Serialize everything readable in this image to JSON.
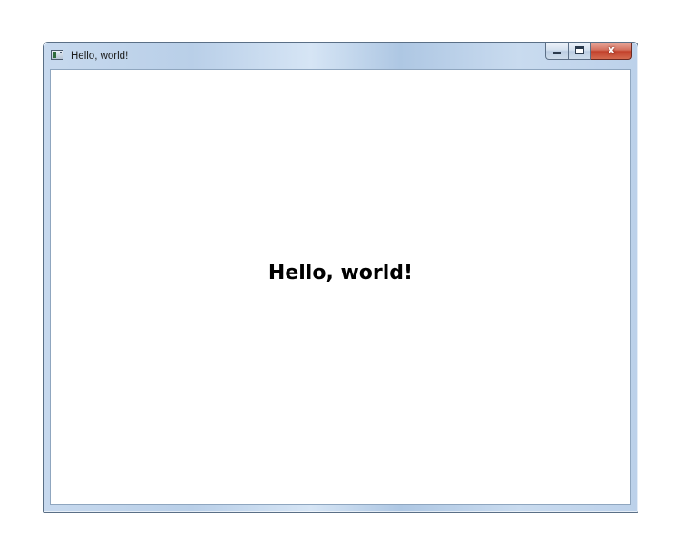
{
  "window": {
    "title": "Hello, world!"
  },
  "caption_buttons": {
    "minimize_icon": "minimize-icon",
    "maximize_icon": "maximize-icon",
    "close_icon": "close-icon",
    "close_glyph": "x"
  },
  "content": {
    "heading": "Hello, world!"
  }
}
